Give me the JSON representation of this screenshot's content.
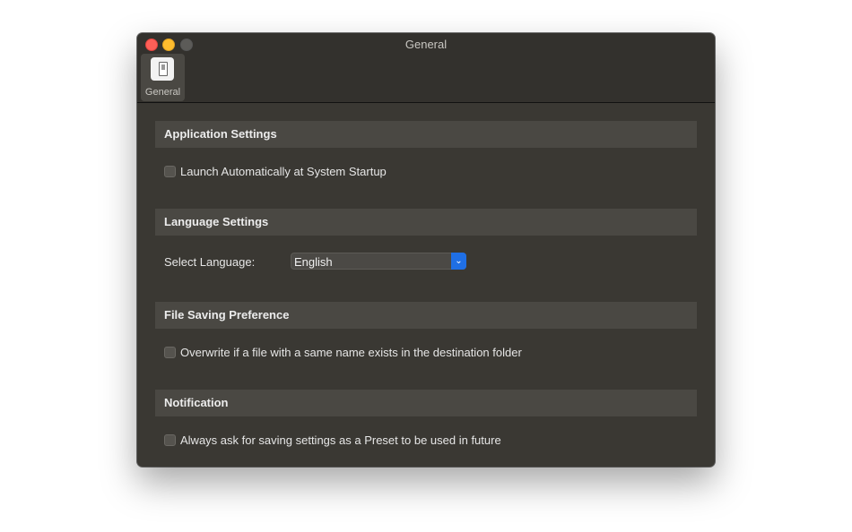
{
  "window": {
    "title": "General"
  },
  "toolbar": {
    "tabs": [
      {
        "label": "General",
        "icon": "general-prefs-icon",
        "selected": true
      }
    ]
  },
  "sections": {
    "application": {
      "header": "Application Settings",
      "launch_at_startup": {
        "label": "Launch Automatically at System Startup",
        "checked": false
      }
    },
    "language": {
      "header": "Language Settings",
      "select_label": "Select Language:",
      "selected_value": "English"
    },
    "file_saving": {
      "header": "File Saving Preference",
      "overwrite": {
        "label": "Overwrite if a file with a same name exists in the destination folder",
        "checked": false
      }
    },
    "notification": {
      "header": "Notification",
      "ask_preset": {
        "label": "Always ask for saving settings as a Preset to be used in future",
        "checked": false
      }
    }
  },
  "colors": {
    "accent": "#1f6fe5",
    "window_bg": "#3a3833",
    "section_bg": "#4a4843"
  }
}
